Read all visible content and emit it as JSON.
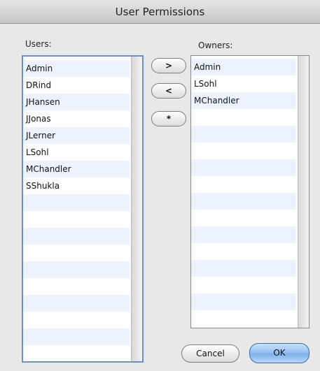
{
  "window": {
    "title": "User Permissions"
  },
  "users": {
    "label": "Users:",
    "items": [
      "Admin",
      "DRind",
      "JHansen",
      "JJonas",
      "JLerner",
      "LSohl",
      "MChandler",
      "SShukla"
    ]
  },
  "owners": {
    "label": "Owners:",
    "items": [
      "Admin",
      "LSohl",
      "MChandler"
    ]
  },
  "buttons": {
    "add": ">",
    "remove": "<",
    "all": "*",
    "cancel": "Cancel",
    "ok": "OK"
  },
  "colors": {
    "focus_ring": "#6f8fc1",
    "alt_row": "#edf3fe",
    "default_button": "#8fbdf0"
  }
}
